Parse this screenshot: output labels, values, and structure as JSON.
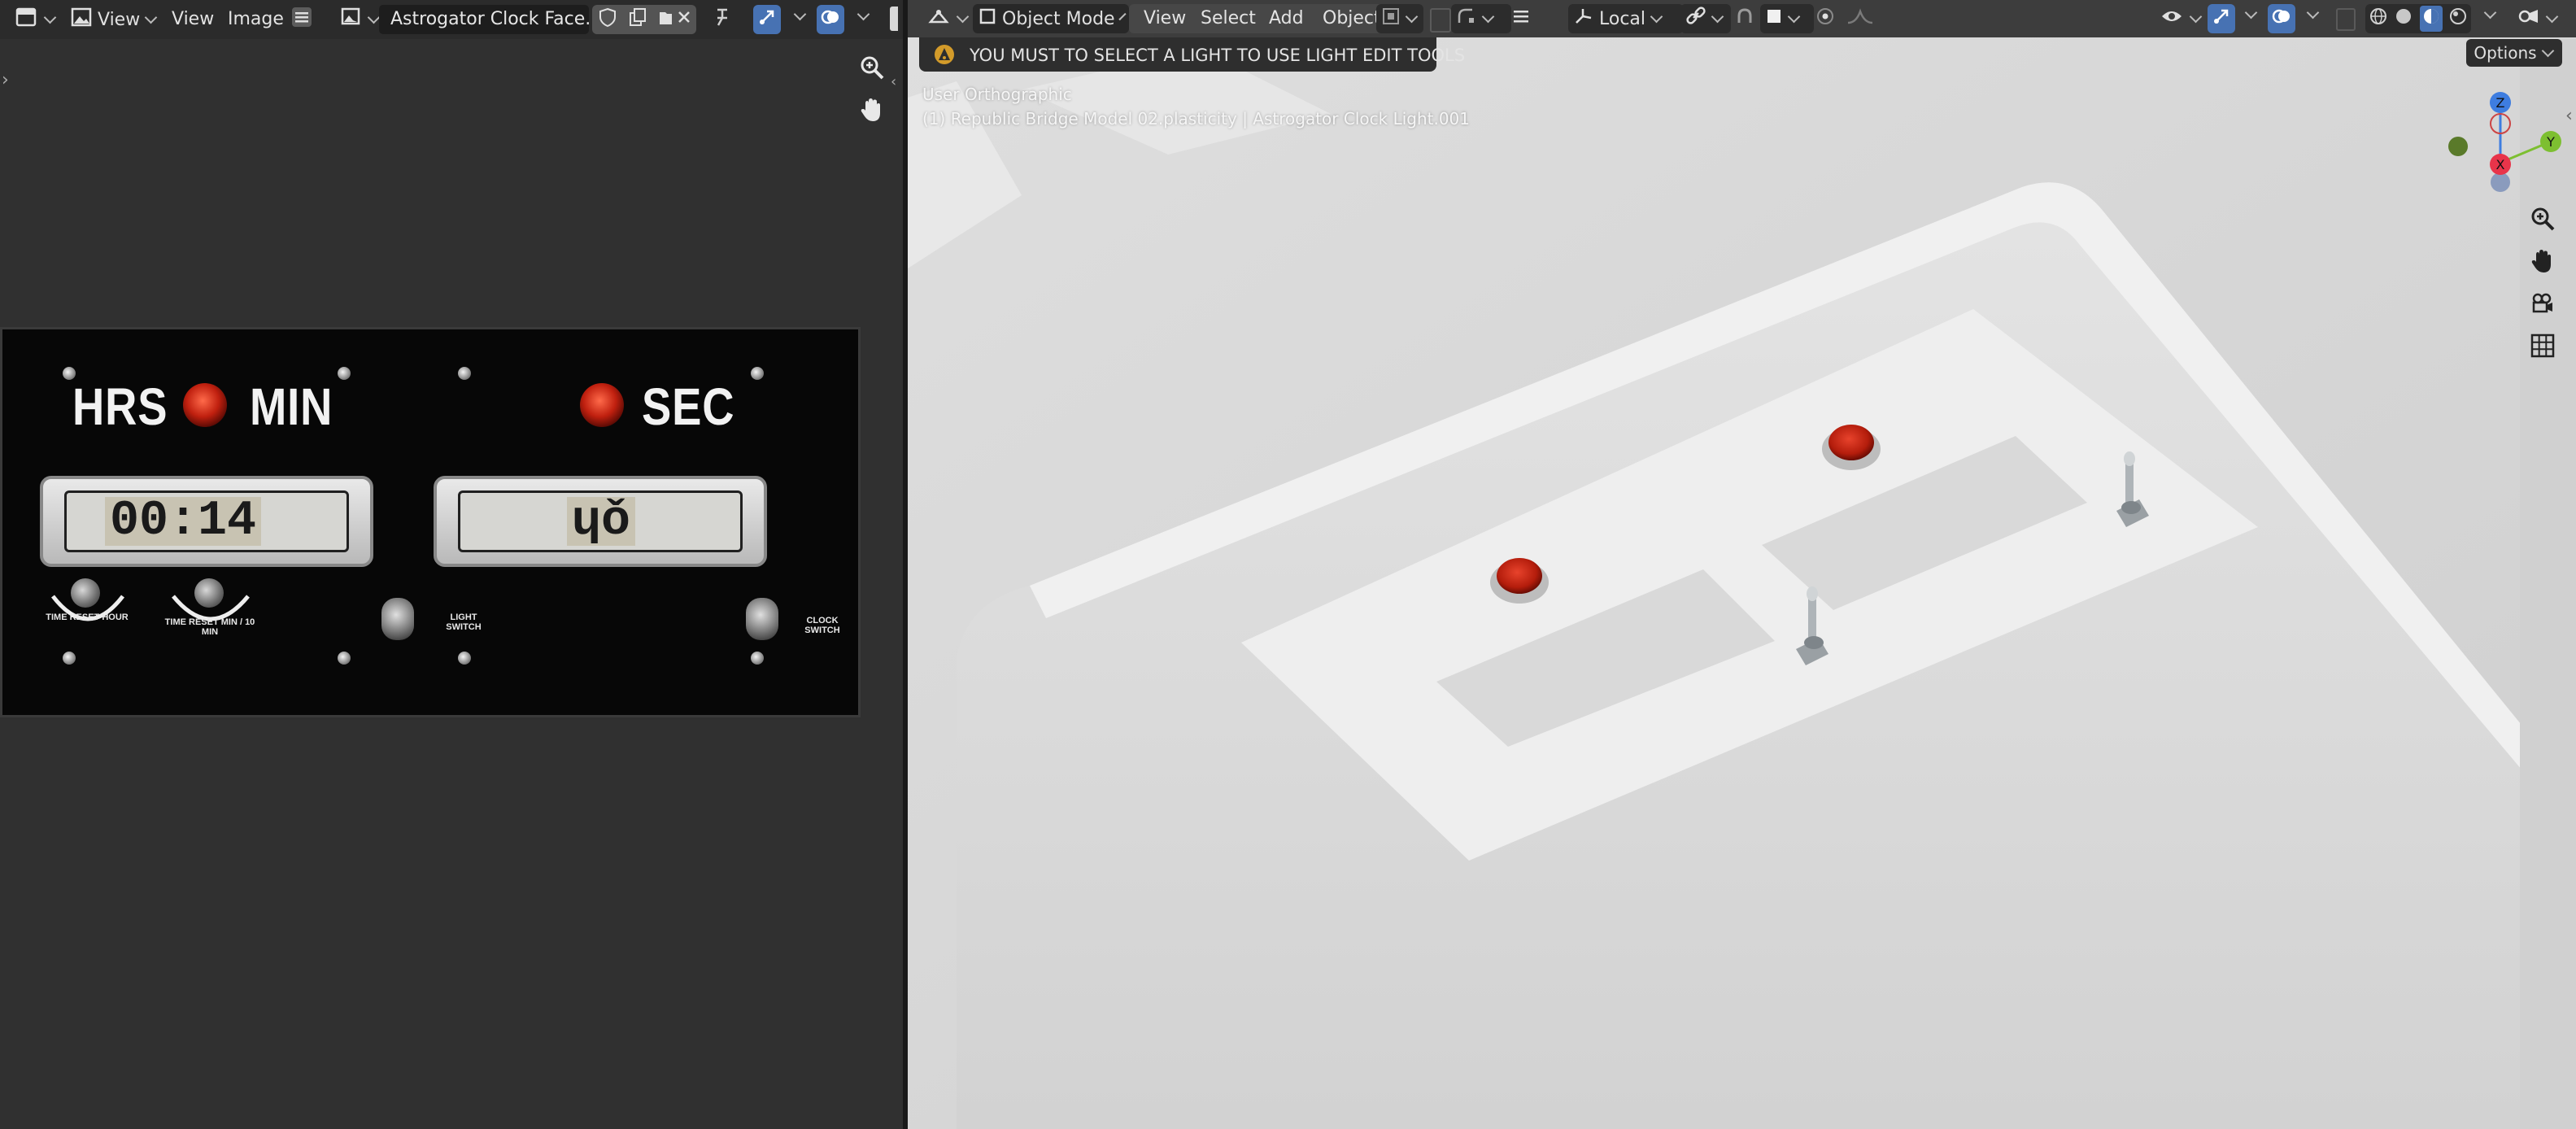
{
  "image_editor": {
    "header": {
      "view_menu_1": "View",
      "view_menu_2": "View",
      "image_menu": "Image",
      "image_name": "Astrogator Clock Face.png"
    },
    "image": {
      "label_hrs": "HRS",
      "label_min": "MIN",
      "label_sec": "SEC",
      "time_display": "00:14",
      "seconds_display": "ɥǒ",
      "caption_reset_hour": "TIME RESET HOUR",
      "caption_reset_min": "TIME RESET MIN / 10 MIN",
      "caption_light_switch": "LIGHT SWITCH",
      "caption_clock_switch": "CLOCK SWITCH"
    }
  },
  "viewport": {
    "header": {
      "mode": "Object Mode",
      "menu_view": "View",
      "menu_select": "Select",
      "menu_add": "Add",
      "menu_object": "Object",
      "transform_orientation": "Local",
      "options": "Options"
    },
    "warning": "YOU MUST TO SELECT A LIGHT TO USE LIGHT EDIT TOOLS",
    "view_name": "User Orthographic",
    "object_info": "(1) Republic Bridge Model 02.plasticity | Astrogator Clock Light.001",
    "gizmo": {
      "z": "Z",
      "y": "Y",
      "x": "X"
    },
    "colors": {
      "x_axis": "#e8344a",
      "y_axis": "#7dbf31",
      "z_axis": "#3e7de0",
      "active_blue": "#4772b3"
    }
  }
}
